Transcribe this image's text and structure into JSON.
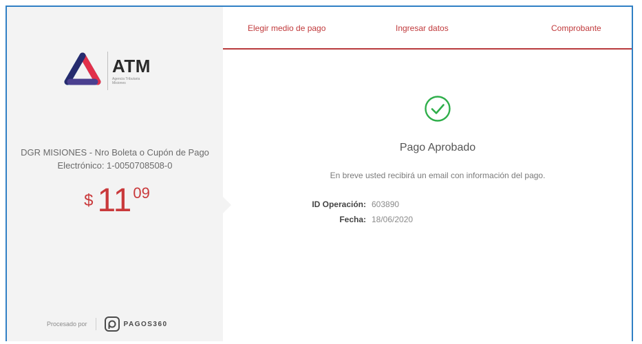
{
  "sidebar": {
    "logo": {
      "title": "ATM",
      "subtitle": "Agencia Tributaria Misiones"
    },
    "concept": "DGR MISIONES - Nro Boleta o Cupón de Pago Electrónico: 1-0050708508-0",
    "amount": {
      "currency": "$",
      "integer": "11",
      "decimals": "09"
    },
    "processed_by": {
      "label": "Procesado por",
      "brand": "PAGOS360"
    }
  },
  "steps": [
    {
      "label": "Elegir medio de pago"
    },
    {
      "label": "Ingresar datos"
    },
    {
      "label": "Comprobante"
    }
  ],
  "result": {
    "title": "Pago Aprobado",
    "message": "En breve usted recibirá un email con información del pago.",
    "details": [
      {
        "label": "ID Operación:",
        "value": "603890"
      },
      {
        "label": "Fecha:",
        "value": "18/06/2020"
      }
    ]
  },
  "colors": {
    "accent": "#c0393b",
    "success": "#2eae4a",
    "frame": "#2f7fc4"
  },
  "icons": {
    "success": "check-circle-icon",
    "brand": "atm-logo-icon",
    "processor": "pagos360-icon"
  }
}
